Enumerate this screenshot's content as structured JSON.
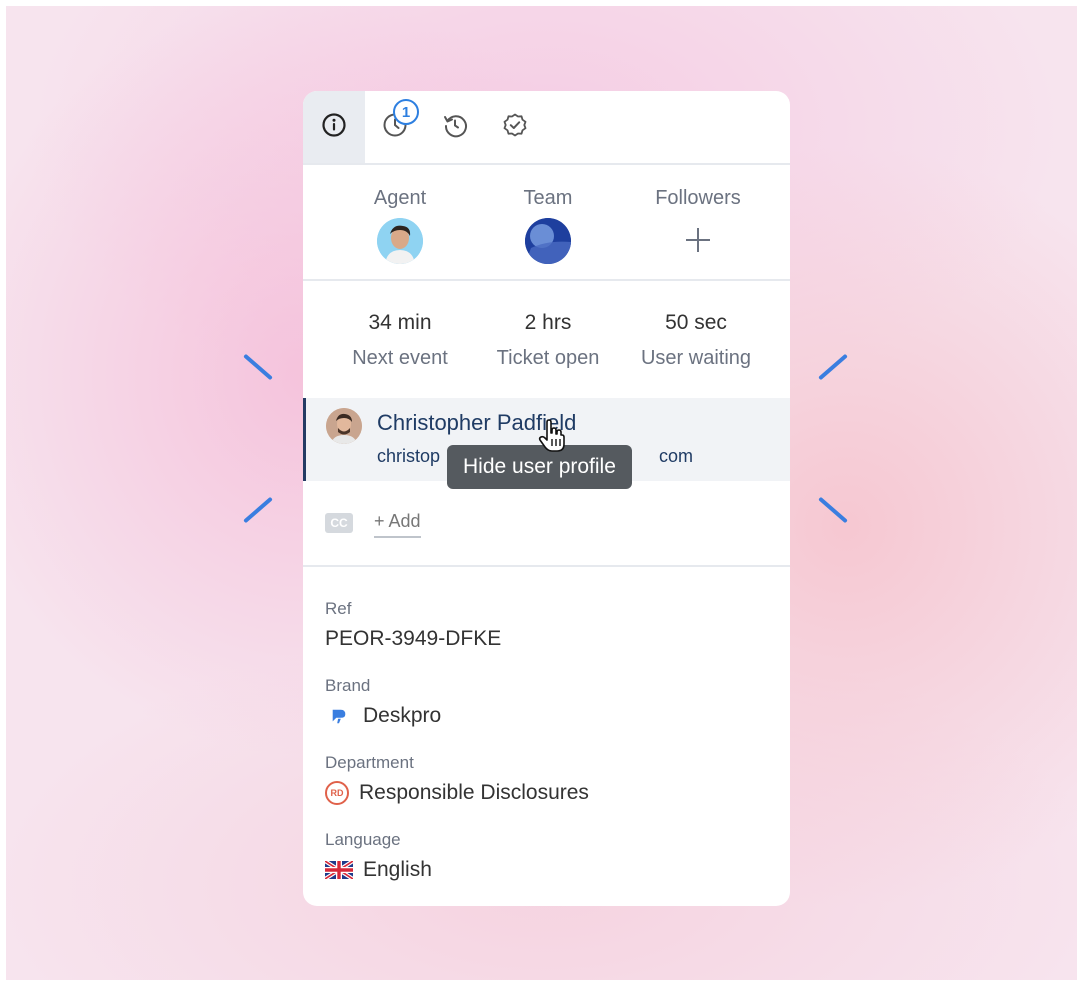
{
  "tabs": {
    "info_icon": "info-icon",
    "sla_icon": "clock-icon",
    "sla_badge": "1",
    "history_icon": "history-icon",
    "tasks_icon": "check-circle-icon"
  },
  "people": {
    "agent_label": "Agent",
    "team_label": "Team",
    "followers_label": "Followers"
  },
  "timers": [
    {
      "value": "34 min",
      "caption": "Next event"
    },
    {
      "value": "2 hrs",
      "caption": "Ticket open"
    },
    {
      "value": "50 sec",
      "caption": "User waiting"
    }
  ],
  "user": {
    "name": "Christopher Padfield",
    "email_start": "christop",
    "email_end": "com",
    "tooltip": "Hide user profile"
  },
  "cc": {
    "icon_text": "CC",
    "add_label": "+ Add"
  },
  "fields": {
    "ref_label": "Ref",
    "ref_value": "PEOR-3949-DFKE",
    "brand_label": "Brand",
    "brand_value": "Deskpro",
    "department_label": "Department",
    "department_badge": "RD",
    "department_value": "Responsible Disclosures",
    "language_label": "Language",
    "language_value": "English"
  },
  "colors": {
    "accent": "#2d7fe0",
    "user_text": "#1f3b64",
    "department_badge": "#e0614a"
  }
}
